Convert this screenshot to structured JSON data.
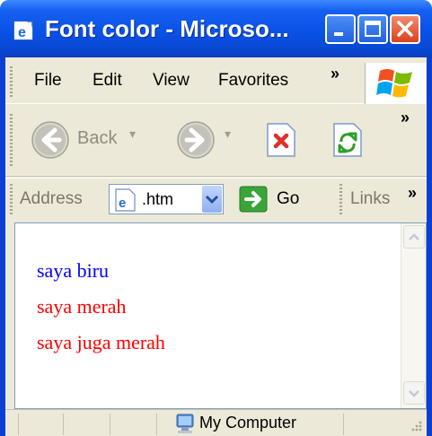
{
  "window": {
    "title": "Font color - Microso..."
  },
  "menu": {
    "items": [
      "File",
      "Edit",
      "View",
      "Favorites"
    ],
    "overflow": "»"
  },
  "nav": {
    "back_label": "Back",
    "overflow": "»"
  },
  "address": {
    "label": "Address",
    "value": ".htm",
    "go_label": "Go",
    "links_label": "Links",
    "overflow": "»"
  },
  "content": {
    "lines": [
      {
        "text": "saya biru",
        "color": "#0000ff"
      },
      {
        "text": "saya merah",
        "color": "#ff0000"
      },
      {
        "text": "saya juga merah",
        "color": "#ff0000"
      }
    ]
  },
  "status": {
    "zone": "My Computer"
  },
  "icons": [
    "ie-page-icon",
    "minimize-icon",
    "maximize-icon",
    "close-icon",
    "windows-logo-icon",
    "back-arrow-icon",
    "forward-arrow-icon",
    "stop-icon",
    "refresh-icon",
    "page-icon",
    "go-arrow-icon",
    "computer-icon",
    "resize-grip-icon",
    "scroll-up-icon",
    "scroll-down-icon"
  ]
}
